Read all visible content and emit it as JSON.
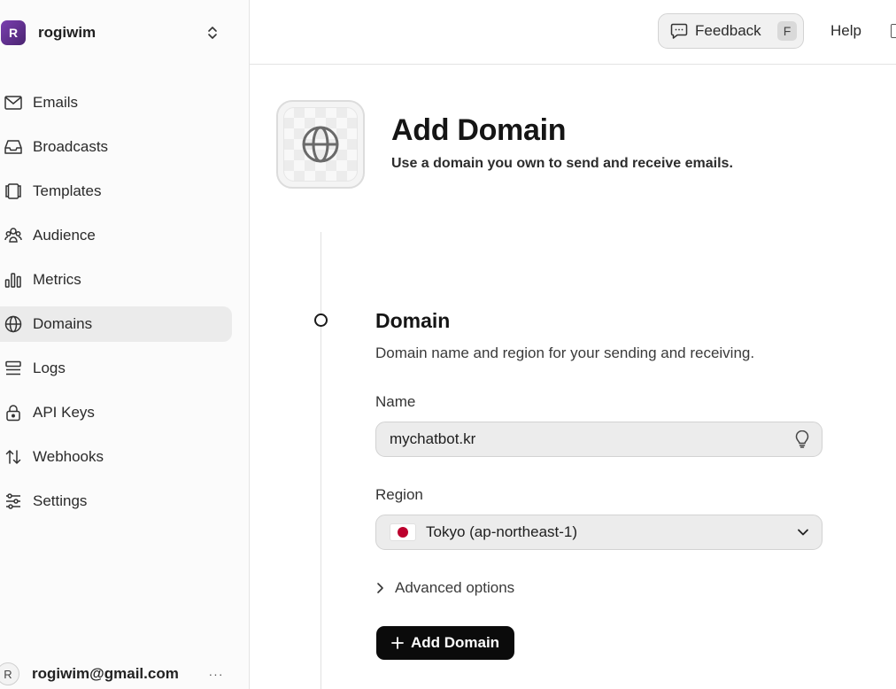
{
  "sidebar": {
    "team": {
      "initial": "R",
      "name": "rogiwim"
    },
    "items": [
      {
        "label": "Emails",
        "icon": "mail-icon"
      },
      {
        "label": "Broadcasts",
        "icon": "inbox-icon"
      },
      {
        "label": "Templates",
        "icon": "templates-icon"
      },
      {
        "label": "Audience",
        "icon": "users-icon"
      },
      {
        "label": "Metrics",
        "icon": "bar-chart-icon"
      },
      {
        "label": "Domains",
        "icon": "globe-icon",
        "active": true
      },
      {
        "label": "Logs",
        "icon": "logs-icon"
      },
      {
        "label": "API Keys",
        "icon": "lock-icon"
      },
      {
        "label": "Webhooks",
        "icon": "arrows-updown-icon"
      },
      {
        "label": "Settings",
        "icon": "sliders-icon"
      }
    ],
    "user": {
      "initial": "R",
      "email": "rogiwim@gmail.com",
      "more": "···"
    }
  },
  "header": {
    "feedback_label": "Feedback",
    "feedback_shortcut": "F",
    "help_label": "Help"
  },
  "page": {
    "title": "Add Domain",
    "subtitle": "Use a domain you own to send and receive emails."
  },
  "section": {
    "title": "Domain",
    "description": "Domain name and region for your sending and receiving.",
    "name_label": "Name",
    "name_value": "mychatbot.kr",
    "region_label": "Region",
    "region_value": "Tokyo (ap-northeast-1)",
    "advanced_label": "Advanced options",
    "submit_label": "Add Domain"
  },
  "colors": {
    "active_bg": "#ebebeb",
    "primary_button": "#0b0b0b",
    "flag_red": "#bc002d"
  }
}
